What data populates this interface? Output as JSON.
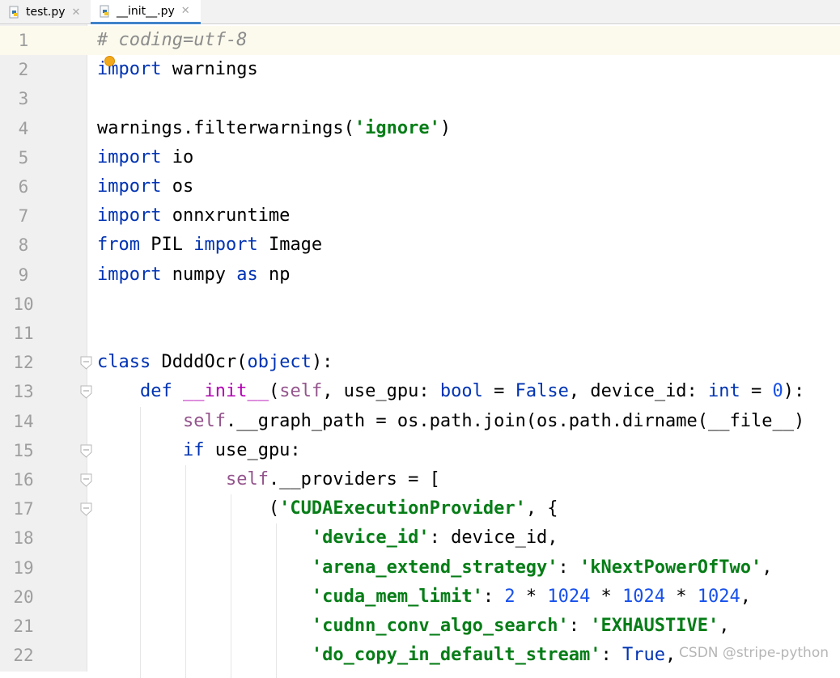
{
  "tabs": [
    {
      "label": "test.py",
      "icon": "python-file-icon",
      "active": false
    },
    {
      "label": "__init__.py",
      "icon": "python-file-icon",
      "active": true
    }
  ],
  "colors": {
    "keyword": "#0033b3",
    "string": "#067d17",
    "number": "#1750eb",
    "comment": "#8c8c8c",
    "self": "#94558d",
    "dunder": "#b200b2",
    "accent": "#4083c9"
  },
  "editor": {
    "current_line": 1,
    "lines": [
      {
        "n": "1",
        "t": "# coding=utf-8"
      },
      {
        "n": "2",
        "t": "import warnings"
      },
      {
        "n": "3",
        "t": ""
      },
      {
        "n": "4",
        "t": "warnings.filterwarnings('ignore')"
      },
      {
        "n": "5",
        "t": "import io"
      },
      {
        "n": "6",
        "t": "import os"
      },
      {
        "n": "7",
        "t": "import onnxruntime"
      },
      {
        "n": "8",
        "t": "from PIL import Image"
      },
      {
        "n": "9",
        "t": "import numpy as np"
      },
      {
        "n": "10",
        "t": ""
      },
      {
        "n": "11",
        "t": ""
      },
      {
        "n": "12",
        "t": "class DdddOcr(object):"
      },
      {
        "n": "13",
        "t": "    def __init__(self, use_gpu: bool = False, device_id: int = 0):"
      },
      {
        "n": "14",
        "t": "        self.__graph_path = os.path.join(os.path.dirname(__file__)"
      },
      {
        "n": "15",
        "t": "        if use_gpu:"
      },
      {
        "n": "16",
        "t": "            self.__providers = ["
      },
      {
        "n": "17",
        "t": "                ('CUDAExecutionProvider', {"
      },
      {
        "n": "18",
        "t": "                    'device_id': device_id,"
      },
      {
        "n": "19",
        "t": "                    'arena_extend_strategy': 'kNextPowerOfTwo',"
      },
      {
        "n": "20",
        "t": "                    'cuda_mem_limit': 2 * 1024 * 1024 * 1024,"
      },
      {
        "n": "21",
        "t": "                    'cudnn_conv_algo_search': 'EXHAUSTIVE',"
      },
      {
        "n": "22",
        "t": "                    'do_copy_in_default_stream': True,"
      }
    ]
  },
  "watermark": "CSDN @stripe-python"
}
